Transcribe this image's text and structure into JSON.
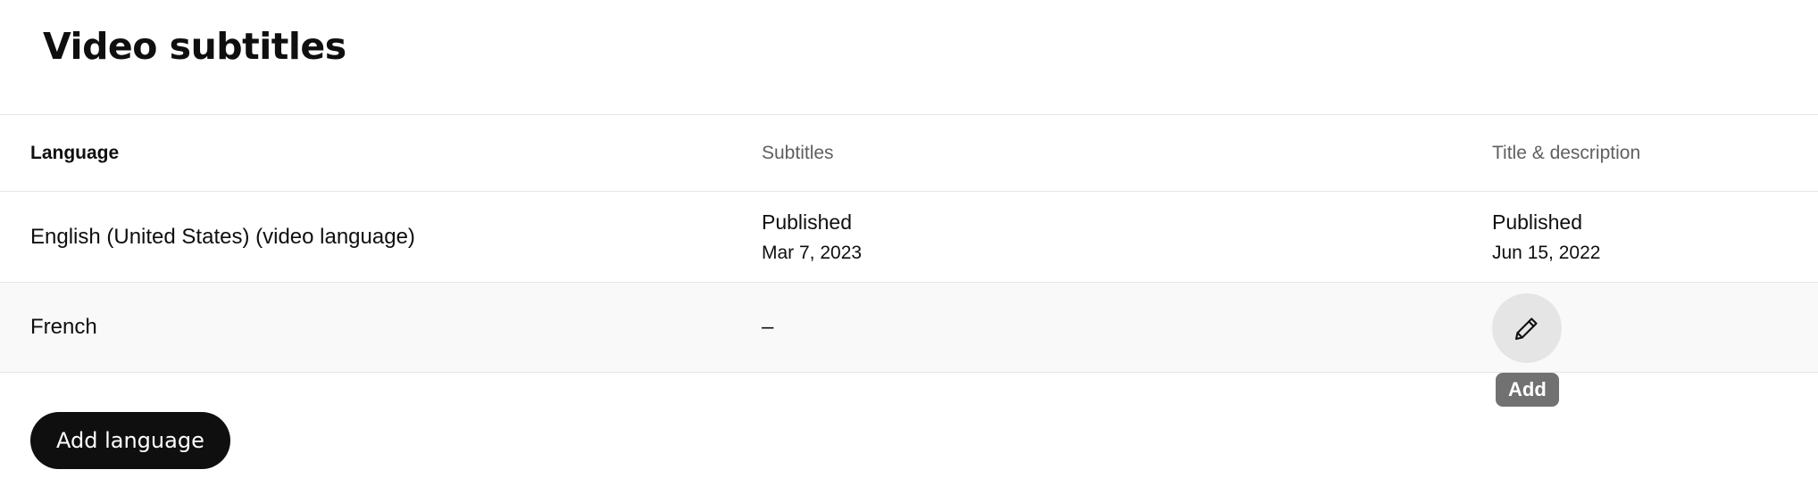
{
  "page": {
    "title": "Video subtitles"
  },
  "table": {
    "headers": {
      "language": "Language",
      "subtitles": "Subtitles",
      "title_description": "Title & description"
    },
    "rows": [
      {
        "language": "English (United States) (video language)",
        "subtitles_status": "Published",
        "subtitles_date": "Mar 7, 2023",
        "title_status": "Published",
        "title_date": "Jun 15, 2022"
      },
      {
        "language": "French",
        "subtitles_value": "–",
        "title_action_icon": "pencil-icon",
        "title_action_tooltip": "Add"
      }
    ]
  },
  "footer": {
    "add_language_label": "Add language"
  },
  "colors": {
    "primary_button_bg": "#0f0f0f",
    "tooltip_bg": "#717171",
    "alt_row_bg": "#f9f9f9",
    "icon_button_bg": "#e5e5e5"
  }
}
